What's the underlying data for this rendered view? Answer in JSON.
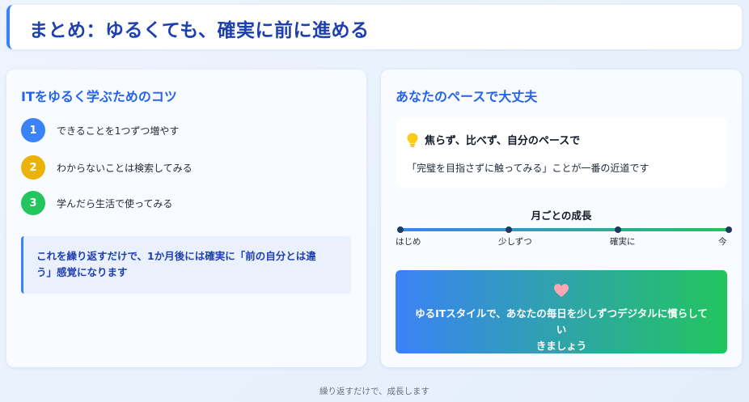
{
  "header": {
    "title": "まとめ：ゆるくても、確実に前に進める"
  },
  "left_card": {
    "title": "ITをゆるく学ぶためのコツ",
    "tips": [
      {
        "number": "1",
        "text": "できることを1つずつ増やす",
        "color": "#3b82f6"
      },
      {
        "number": "2",
        "text": "わからないことは検索してみる",
        "color": "#eab308"
      },
      {
        "number": "3",
        "text": "学んだら生活で使ってみる",
        "color": "#22c55e"
      }
    ],
    "callout_line1": "これを繰り返すだけで、1か月後には確実に「前の自分とは違",
    "callout_line2": "う」感覚になります"
  },
  "right_card": {
    "title": "あなたのペースで大丈夫",
    "note": {
      "icon": "lightbulb-icon",
      "heading": "焦らず、比べず、自分のペースで",
      "body": "「完璧を目指さずに触ってみる」ことが一番の近道です"
    },
    "growth": {
      "title": "月ごとの成長",
      "labels": [
        "はじめ",
        "少しずつ",
        "確実に",
        "今"
      ]
    },
    "banner": {
      "icon": "heart-icon",
      "line1": "ゆるITスタイルで、あなたの毎日を少しずつデジタルに慣らしてい",
      "line2": "きましょう"
    }
  },
  "footer": {
    "text": "繰り返すだけで、成長します"
  },
  "colors": {
    "accent": "#2563eb",
    "title": "#1e40af",
    "heart": "#f9a8b4"
  }
}
